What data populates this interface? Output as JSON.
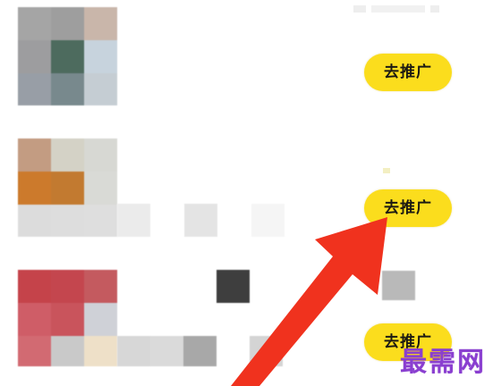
{
  "list": {
    "items": [
      {
        "promote_label": "去推广"
      },
      {
        "promote_label": "去推广"
      },
      {
        "promote_label": "去推广"
      }
    ]
  },
  "colors": {
    "button_bg": "#fbdd1d",
    "button_text": "#1c1a12",
    "arrow": "#f0321e",
    "watermark": "#8a3fd0"
  },
  "icons": {
    "arrow": "red-pointer-arrow-icon"
  },
  "watermark": {
    "text": "最需网"
  }
}
